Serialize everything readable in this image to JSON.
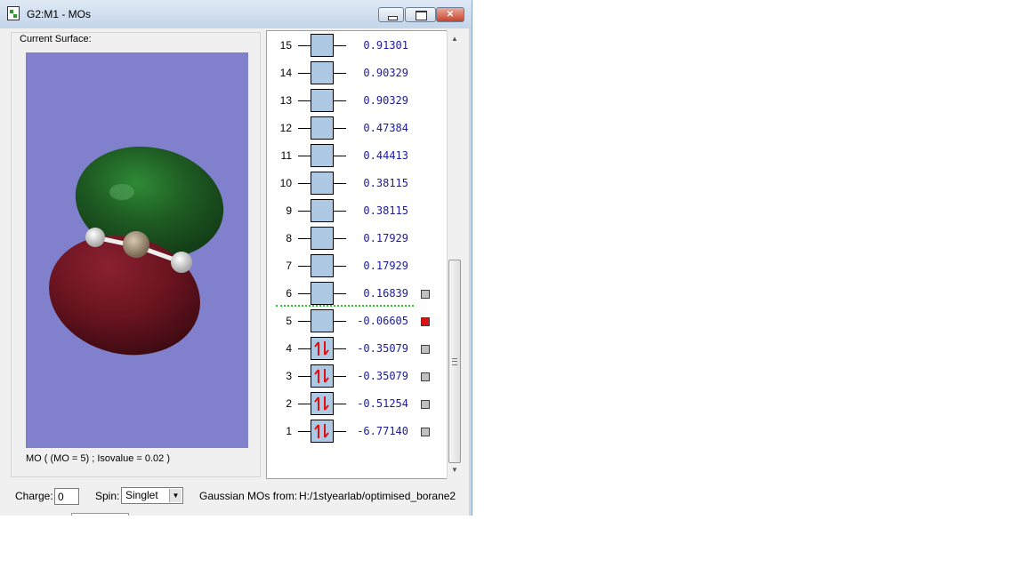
{
  "window": {
    "title": "G2:M1 - MOs",
    "controls": [
      "minimize",
      "maximize",
      "close"
    ]
  },
  "surface": {
    "label": "Current Surface:",
    "caption": "MO ( (MO = 5) ; Isovalue = 0.02 )",
    "background_color": "#8080cc",
    "lobe_colors": {
      "positive": "#1e5a22",
      "negative": "#6a1420"
    }
  },
  "orbitals": [
    {
      "num": "15",
      "energy": "0.91301",
      "occupied": false,
      "check": "none"
    },
    {
      "num": "14",
      "energy": "0.90329",
      "occupied": false,
      "check": "none"
    },
    {
      "num": "13",
      "energy": "0.90329",
      "occupied": false,
      "check": "none"
    },
    {
      "num": "12",
      "energy": "0.47384",
      "occupied": false,
      "check": "none"
    },
    {
      "num": "11",
      "energy": "0.44413",
      "occupied": false,
      "check": "none"
    },
    {
      "num": "10",
      "energy": "0.38115",
      "occupied": false,
      "check": "none"
    },
    {
      "num": "9",
      "energy": "0.38115",
      "occupied": false,
      "check": "none"
    },
    {
      "num": "8",
      "energy": "0.17929",
      "occupied": false,
      "check": "none"
    },
    {
      "num": "7",
      "energy": "0.17929",
      "occupied": false,
      "check": "none"
    },
    {
      "num": "6",
      "energy": "0.16839",
      "occupied": false,
      "check": "gray"
    },
    {
      "num": "5",
      "energy": "-0.06605",
      "occupied": false,
      "check": "red"
    },
    {
      "num": "4",
      "energy": "-0.35079",
      "occupied": true,
      "check": "gray"
    },
    {
      "num": "3",
      "energy": "-0.35079",
      "occupied": true,
      "check": "gray"
    },
    {
      "num": "2",
      "energy": "-0.51254",
      "occupied": true,
      "check": "gray"
    },
    {
      "num": "1",
      "energy": "-6.77140",
      "occupied": true,
      "check": "gray"
    }
  ],
  "colors": {
    "energy_text": "#1a1aa0",
    "orbital_box": "#aec9e3",
    "homo_lumo_divider": "#22cc22",
    "electron_arrows": "#e01010"
  },
  "footer": {
    "charge_label": "Charge:",
    "charge_value": "0",
    "spin_label": "Spin:",
    "spin_value": "Singlet",
    "source_label": "Gaussian MOs from:",
    "source_path": "H:/1styearlab/optimised_borane2"
  }
}
